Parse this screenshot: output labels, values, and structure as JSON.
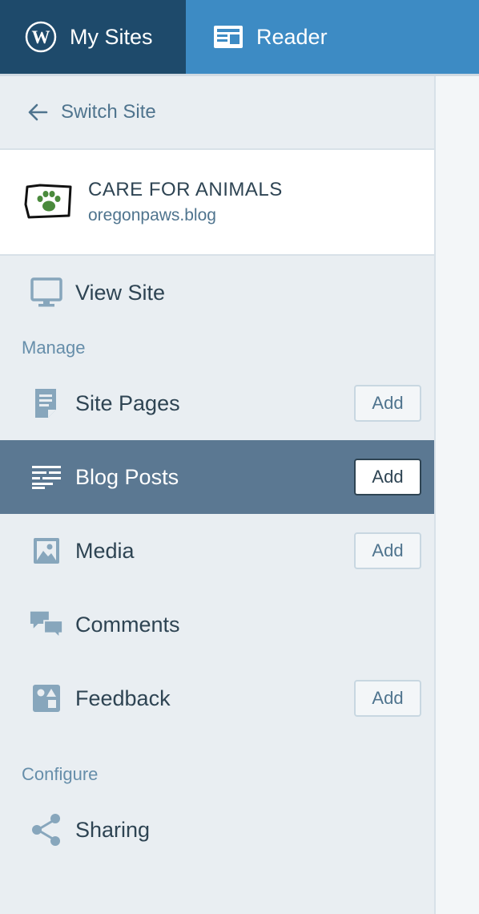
{
  "topbar": {
    "my_sites_label": "My Sites",
    "reader_label": "Reader"
  },
  "sidebar": {
    "switch_site_label": "Switch Site",
    "site": {
      "title": "CARE FOR ANIMALS",
      "domain": "oregonpaws.blog"
    },
    "view_site_label": "View Site",
    "sections": {
      "manage": "Manage",
      "configure": "Configure"
    },
    "items": [
      {
        "label": "Site Pages",
        "add_label": "Add",
        "icon": "page-icon"
      },
      {
        "label": "Blog Posts",
        "add_label": "Add",
        "icon": "posts-icon",
        "selected": true
      },
      {
        "label": "Media",
        "add_label": "Add",
        "icon": "image-icon"
      },
      {
        "label": "Comments",
        "icon": "comments-icon"
      },
      {
        "label": "Feedback",
        "add_label": "Add",
        "icon": "feedback-icon"
      }
    ],
    "configure_items": [
      {
        "label": "Sharing",
        "icon": "share-icon"
      }
    ]
  },
  "colors": {
    "accent": "#3d8bc4",
    "active_tab": "#1e4a6b",
    "selected_row": "#5b7892",
    "sidebar_bg": "#e9eef2"
  }
}
